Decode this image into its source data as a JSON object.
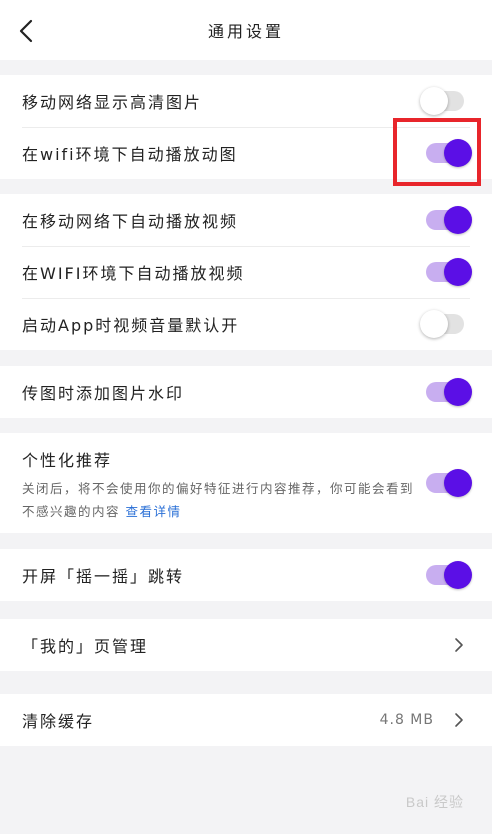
{
  "header": {
    "title": "通用设置",
    "back_icon": "chevron-left-icon"
  },
  "groups": [
    {
      "items": [
        {
          "label": "移动网络显示高清图片",
          "toggle": "off"
        },
        {
          "label": "在wifi环境下自动播放动图",
          "toggle": "on"
        }
      ]
    },
    {
      "items": [
        {
          "label": "在移动网络下自动播放视频",
          "toggle": "on"
        },
        {
          "label": "在WIFI环境下自动播放视频",
          "toggle": "on"
        },
        {
          "label": "启动App时视频音量默认开",
          "toggle": "off"
        }
      ]
    },
    {
      "items": [
        {
          "label": "传图时添加图片水印",
          "toggle": "on"
        }
      ]
    },
    {
      "items": [
        {
          "label": "个性化推荐",
          "toggle": "on",
          "description": "关闭后，将不会使用你的偏好特征进行内容推荐，你可能会看到不感兴趣的内容",
          "link": "查看详情"
        }
      ]
    },
    {
      "items": [
        {
          "label": "开屏「摇一摇」跳转",
          "toggle": "on"
        }
      ]
    },
    {
      "items": [
        {
          "label": "「我的」页管理",
          "chevron": "chevron-right-icon"
        }
      ]
    },
    {
      "items": [
        {
          "label": "清除缓存",
          "value": "4.8 MB",
          "chevron": "chevron-right-icon"
        }
      ]
    }
  ],
  "watermark": "Bai 经验",
  "colors": {
    "accent": "#5b0fe6",
    "toggle_track_on": "#c8aef0",
    "toggle_track_off": "#e2e2e2",
    "highlight": "#e8252b",
    "link": "#2a6fd6",
    "background": "#f3f3f5"
  }
}
